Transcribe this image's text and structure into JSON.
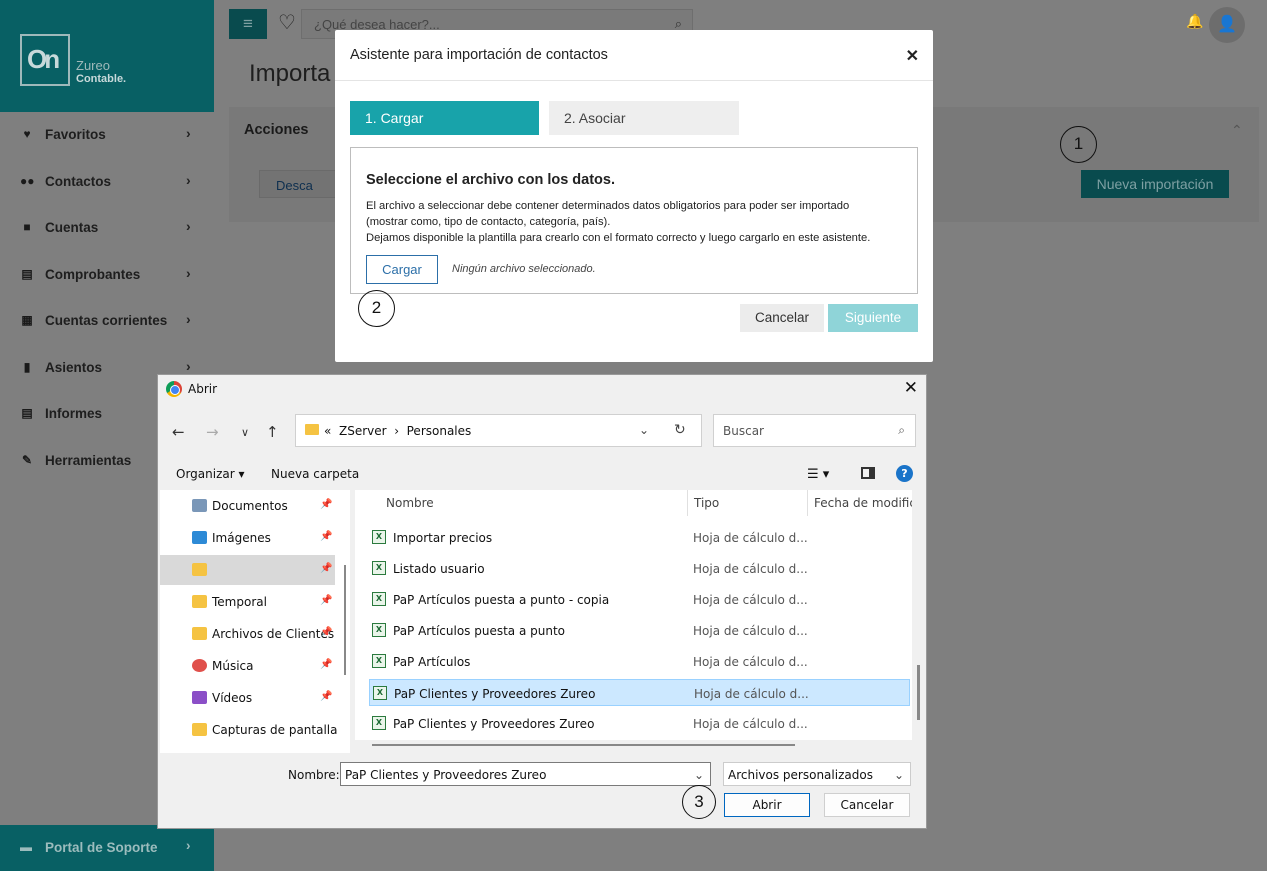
{
  "app": {
    "logo_mark": "On",
    "logo_name": "Zureo",
    "logo_sub": "Contable.",
    "search_placeholder": "¿Qué desea hacer?...",
    "page_title": "Importa",
    "support_label": "Portal de Soporte"
  },
  "sidebar": {
    "items": [
      {
        "label": "Favoritos",
        "icon": "heart-icon"
      },
      {
        "label": "Contactos",
        "icon": "users-icon"
      },
      {
        "label": "Cuentas",
        "icon": "briefcase-icon"
      },
      {
        "label": "Comprobantes",
        "icon": "receipt-icon"
      },
      {
        "label": "Cuentas corrientes",
        "icon": "calculator-icon"
      },
      {
        "label": "Asientos",
        "icon": "book-icon"
      },
      {
        "label": "Informes",
        "icon": "report-icon"
      },
      {
        "label": "Herramientas",
        "icon": "wrench-icon"
      }
    ]
  },
  "acciones": {
    "title": "Acciones",
    "descargar_label": "Desca",
    "nueva_importacion_label": "Nueva importación"
  },
  "annotations": {
    "c1": "1",
    "c2": "2",
    "c3": "3"
  },
  "wizard": {
    "title": "Asistente para importación de contactos",
    "step1": "1. Cargar",
    "step2": "2. Asociar",
    "heading": "Seleccione el archivo con los datos.",
    "line1": "El archivo a seleccionar debe contener determinados datos obligatorios para poder ser importado",
    "line2": "(mostrar como, tipo de contacto, categoría, país).",
    "line3": "Dejamos disponible la plantilla para crearlo con el formato correcto y luego cargarlo en este asistente.",
    "cargar_label": "Cargar",
    "no_file": "Ningún archivo seleccionado.",
    "cancel_label": "Cancelar",
    "next_label": "Siguiente"
  },
  "file_dialog": {
    "title": "Abrir",
    "path_prefix": "«",
    "path": [
      "ZServer",
      "Personales"
    ],
    "search_placeholder": "Buscar",
    "organizar": "Organizar",
    "nueva_carpeta": "Nueva carpeta",
    "columns": {
      "name": "Nombre",
      "type": "Tipo",
      "date": "Fecha de modifica"
    },
    "nav_items": [
      {
        "label": "Documentos",
        "icon": "documents-icon",
        "color": "#5a7fa8"
      },
      {
        "label": "Imágenes",
        "icon": "pictures-icon",
        "color": "#2d8ad6"
      },
      {
        "label": "",
        "icon": "folder-icon",
        "color": "#f5c342"
      },
      {
        "label": "Temporal",
        "icon": "folder-icon",
        "color": "#f5c342"
      },
      {
        "label": "Archivos de Clientes",
        "icon": "folder-icon",
        "color": "#f5c342"
      },
      {
        "label": "Música",
        "icon": "music-icon",
        "color": "#e0504b"
      },
      {
        "label": "Vídeos",
        "icon": "videos-icon",
        "color": "#8b4fc7"
      },
      {
        "label": "Capturas de pantalla",
        "icon": "folder-icon",
        "color": "#f5c342"
      }
    ],
    "files": [
      {
        "name": "Importar precios",
        "type": "Hoja de cálculo d..."
      },
      {
        "name": "Listado usuario",
        "type": "Hoja de cálculo d..."
      },
      {
        "name": "PaP Artículos puesta a punto - copia",
        "type": "Hoja de cálculo d..."
      },
      {
        "name": "PaP Artículos puesta a punto",
        "type": "Hoja de cálculo d..."
      },
      {
        "name": "PaP Artículos",
        "type": "Hoja de cálculo d..."
      },
      {
        "name": "PaP Clientes y Proveedores Zureo",
        "type": "Hoja de cálculo d..."
      },
      {
        "name": "PaP Clientes y Proveedores Zureo",
        "type": "Hoja de cálculo d..."
      }
    ],
    "filename_label": "Nombre:",
    "filename_value": "PaP Clientes y Proveedores Zureo",
    "filetype_value": "Archivos personalizados",
    "open_label": "Abrir",
    "cancel_label": "Cancelar"
  }
}
